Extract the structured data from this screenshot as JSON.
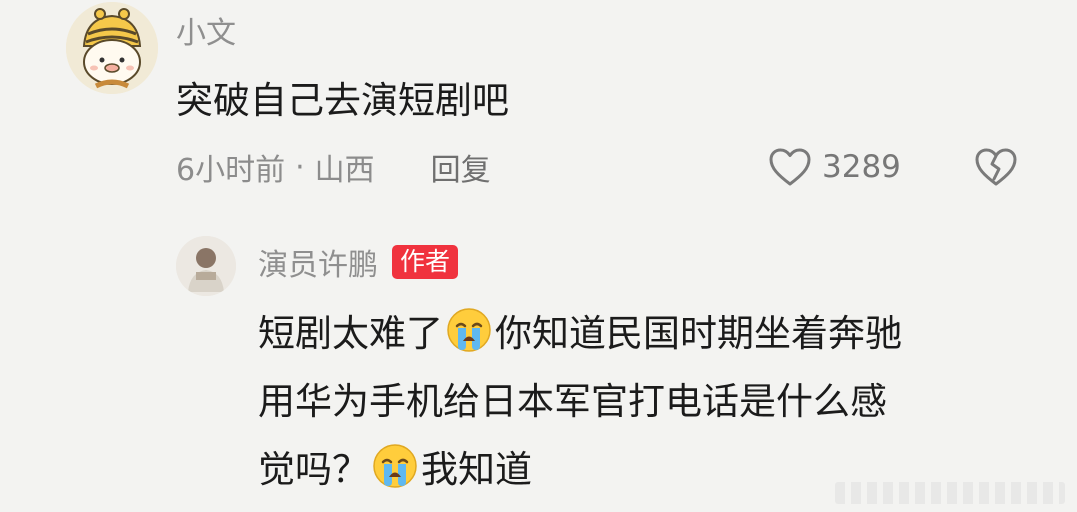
{
  "comment": {
    "username": "小文",
    "text": "突破自己去演短剧吧",
    "time": "6小时前",
    "separator": "·",
    "location": "山西",
    "reply_label": "回复",
    "like_count": "3289",
    "icons": {
      "avatar": "cartoon-bee-hat-avatar",
      "like": "heart-outline-icon",
      "dislike": "broken-heart-icon"
    }
  },
  "reply": {
    "username": "演员许鹏",
    "badge": "作者",
    "line1_a": "短剧太难了",
    "line1_b": "你知道民国时期坐着奔驰",
    "line2": "用华为手机给日本军官打电话是什么感",
    "line3_a": "觉吗？",
    "line3_b": "我知道",
    "icons": {
      "avatar": "photo-avatar",
      "emoji": "crying-face-emoji"
    }
  },
  "colors": {
    "background": "#f3f3f1",
    "text": "#1b1b1b",
    "muted": "#8f8f8f",
    "badge": "#f0323e"
  }
}
